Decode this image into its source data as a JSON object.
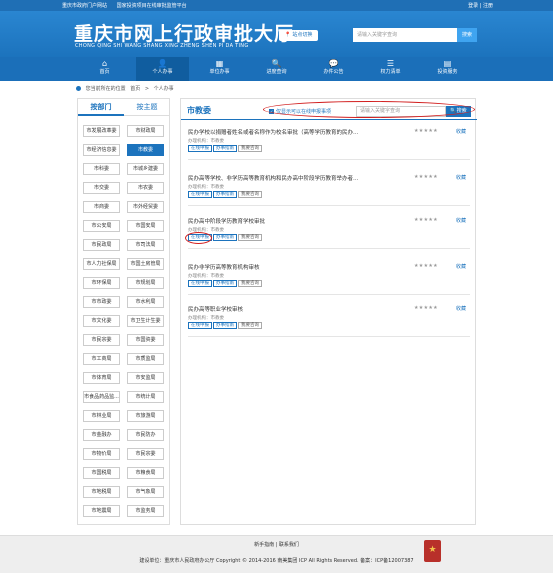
{
  "topbar": {
    "links": [
      "重庆市政府门户网站",
      "国家投资项目在线审批监管平台"
    ],
    "right": "登录 | 注册"
  },
  "banner": {
    "title_cn": "重庆市网上行政审批大厅",
    "title_en": "CHONG QING SHI WANG SHANG XING ZHENG SHEN PI DA TING",
    "hall_badge": "📍 站点切换",
    "search_placeholder": "请输入关键字查询",
    "search_button": "搜索"
  },
  "nav": [
    {
      "icon": "home-icon",
      "glyph": "⌂",
      "label": "首页"
    },
    {
      "icon": "person-icon",
      "glyph": "👤",
      "label": "个人办事"
    },
    {
      "icon": "building-icon",
      "glyph": "▦",
      "label": "单位办事"
    },
    {
      "icon": "search-icon",
      "glyph": "🔍",
      "label": "进度查询"
    },
    {
      "icon": "chat-icon",
      "glyph": "💬",
      "label": "办件公告"
    },
    {
      "icon": "list-icon",
      "glyph": "☰",
      "label": "权力清单"
    },
    {
      "icon": "server-icon",
      "glyph": "▤",
      "label": "投资服务"
    }
  ],
  "breadcrumb": {
    "prefix": "您当前所在的位置",
    "items": [
      "首页",
      ">",
      "个人办事"
    ]
  },
  "left": {
    "tab_active": "按部门",
    "tab_inactive": "按主题",
    "departments": [
      [
        "市发展改革委",
        "市财政局"
      ],
      [
        "市经济信息委",
        "市教委"
      ],
      [
        "市科委",
        "市城乡建委"
      ],
      [
        "市交委",
        "市农委"
      ],
      [
        "市商委",
        "市外经贸委"
      ],
      [
        "市公安局",
        "市国安局"
      ],
      [
        "市民政局",
        "市司法局"
      ],
      [
        "市人力社保局",
        "市国土房管局"
      ],
      [
        "市环保局",
        "市规划局"
      ],
      [
        "市市政委",
        "市水利局"
      ],
      [
        "市文化委",
        "市卫生计生委"
      ],
      [
        "市民宗委",
        "市国资委"
      ],
      [
        "市工商局",
        "市质监局"
      ],
      [
        "市体育局",
        "市安监局"
      ],
      [
        "市食品药品监...",
        "市统计局"
      ],
      [
        "市林业局",
        "市旅游局"
      ],
      [
        "市金融办",
        "市民防办"
      ],
      [
        "市物价局",
        "市民宗委"
      ],
      [
        "市国税局",
        "市粮食局"
      ],
      [
        "市地税局",
        "市气象局"
      ],
      [
        "市地震局",
        "市监务局"
      ]
    ],
    "active_department": "市教委"
  },
  "right": {
    "title": "市教委",
    "filter_label": "仅显示可以在线申报事项",
    "search_placeholder": "请输入关键字查询",
    "search_button": "🔍搜索",
    "items": [
      {
        "title": "民办学校以捐赠者姓名或者名称作为校名审批（高等学历教育的民办…",
        "stars": "★★★★★",
        "fav": "收藏",
        "meta": "办理机构：市教委",
        "buttons": [
          "在线申报",
          "办事指南",
          "我要咨询"
        ]
      },
      {
        "title": "民办高等学校、非学历高等教育机构和民办高中阶段学历教育举办者…",
        "stars": "★★★★★",
        "fav": "收藏",
        "meta": "办理机构：市教委",
        "buttons": [
          "在线申报",
          "办事指南",
          "我要咨询"
        ]
      },
      {
        "title": "民办高中阶段学历教育学校审批",
        "stars": "★★★★★",
        "fav": "收藏",
        "meta": "办理机构：市教委",
        "buttons": [
          "在线申报",
          "办事指南",
          "我要咨询"
        ]
      },
      {
        "title": "民办非学历高等教育机构审核",
        "stars": "★★★★★",
        "fav": "收藏",
        "meta": "办理机构：市教委",
        "buttons": [
          "在线申报",
          "办事指南",
          "我要咨询"
        ]
      },
      {
        "title": "民办高等职业学校审核",
        "stars": "★★★★★",
        "fav": "收藏",
        "meta": "办理机构：市教委",
        "buttons": [
          "在线申报",
          "办事指南",
          "我要咨询"
        ]
      }
    ]
  },
  "footer": {
    "links": "新手指南 | 联系我们",
    "copyright": "建设单位：重庆市人民政府办公厅   Copyright © 2014-2016 南美集团 ICP All Rights Reserved.   备案：ICP备12007387",
    "emblem": "★"
  }
}
